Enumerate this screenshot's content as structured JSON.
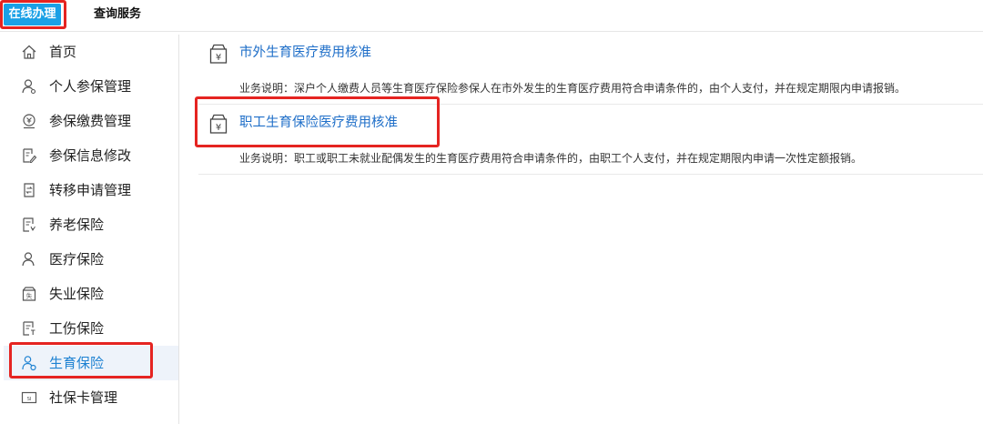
{
  "top_tabs": [
    {
      "label": "在线办理",
      "active": true
    },
    {
      "label": "查询服务",
      "active": false
    }
  ],
  "sidebar": {
    "items": [
      {
        "label": "首页",
        "icon": "home-icon"
      },
      {
        "label": "个人参保管理",
        "icon": "user-icon"
      },
      {
        "label": "参保缴费管理",
        "icon": "payment-icon"
      },
      {
        "label": "参保信息修改",
        "icon": "edit-icon"
      },
      {
        "label": "转移申请管理",
        "icon": "transfer-icon"
      },
      {
        "label": "养老保险",
        "icon": "document-icon"
      },
      {
        "label": "医疗保险",
        "icon": "user-icon"
      },
      {
        "label": "失业保险",
        "icon": "inbox-icon"
      },
      {
        "label": "工伤保险",
        "icon": "document-icon"
      },
      {
        "label": "生育保险",
        "icon": "maternity-icon",
        "active": true
      },
      {
        "label": "社保卡管理",
        "icon": "card-icon"
      }
    ]
  },
  "services": [
    {
      "title": "市外生育医疗费用核准",
      "description": "业务说明：深户个人缴费人员等生育医疗保险参保人在市外发生的生育医疗费用符合申请条件的，由个人支付，并在规定期限内申请报销。",
      "icon": "yuan-bag-icon"
    },
    {
      "title": "职工生育保险医疗费用核准",
      "description": "业务说明：职工或职工未就业配偶发生的生育医疗费用符合申请条件的，由职工个人支付，并在规定期限内申请一次性定额报销。",
      "icon": "yuan-bag-icon"
    }
  ],
  "colors": {
    "accent_tab": "#1aa0e6",
    "link": "#1e6ec8",
    "active_label": "#1e82d2",
    "highlight": "#e52421",
    "active_bg": "#eef3fa"
  }
}
